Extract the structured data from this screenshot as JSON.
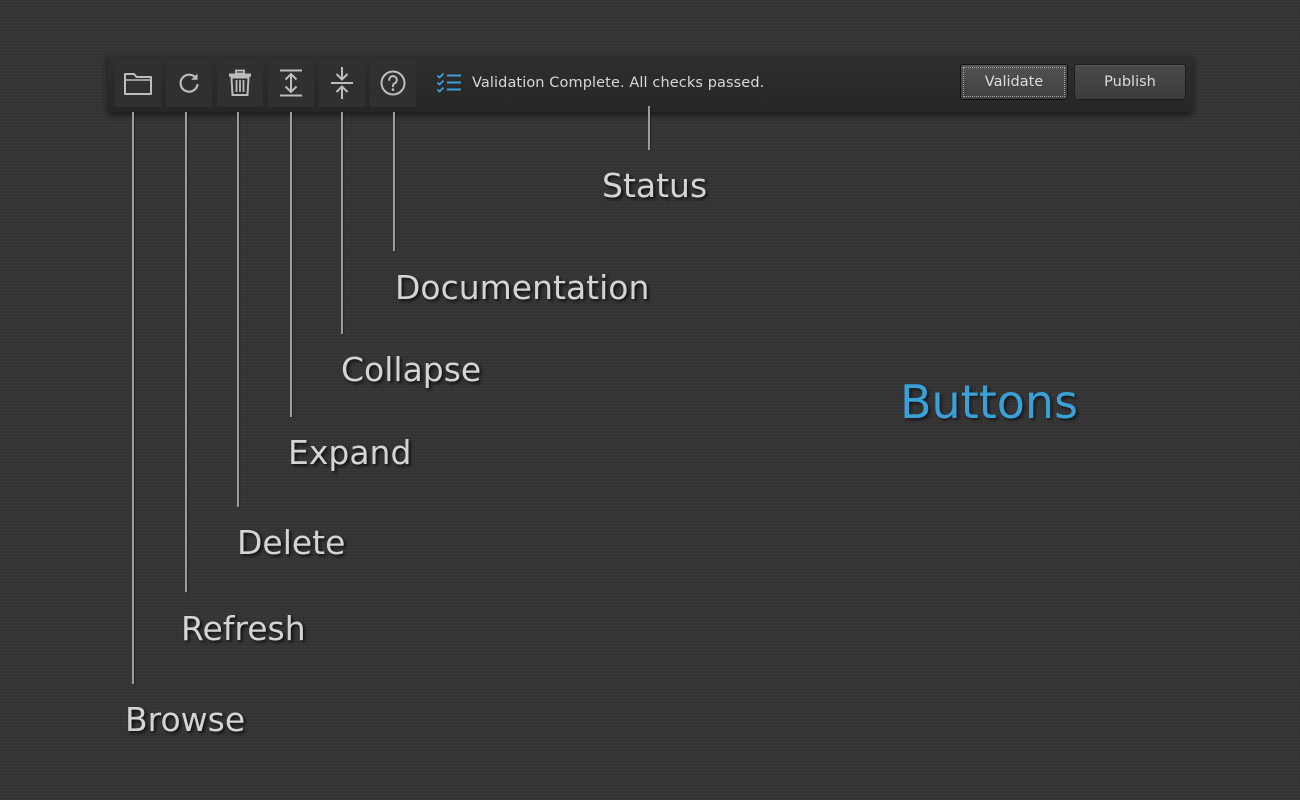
{
  "toolbar": {
    "tools": [
      {
        "name": "browse",
        "icon": "folder-icon"
      },
      {
        "name": "refresh",
        "icon": "refresh-icon"
      },
      {
        "name": "delete",
        "icon": "trash-icon"
      },
      {
        "name": "expand",
        "icon": "expand-icon"
      },
      {
        "name": "collapse",
        "icon": "collapse-icon"
      },
      {
        "name": "documentation",
        "icon": "help-icon"
      }
    ],
    "status": {
      "icon": "checklist-icon",
      "text": "Validation Complete. All checks passed."
    },
    "validate_label": "Validate",
    "publish_label": "Publish"
  },
  "callouts": {
    "status": "Status",
    "documentation": "Documentation",
    "collapse": "Collapse",
    "expand": "Expand",
    "delete": "Delete",
    "refresh": "Refresh",
    "browse": "Browse"
  },
  "heading": "Buttons",
  "colors": {
    "accent": "#3aa0d8",
    "background": "#353535",
    "toolbar": "#2a2a2a"
  }
}
